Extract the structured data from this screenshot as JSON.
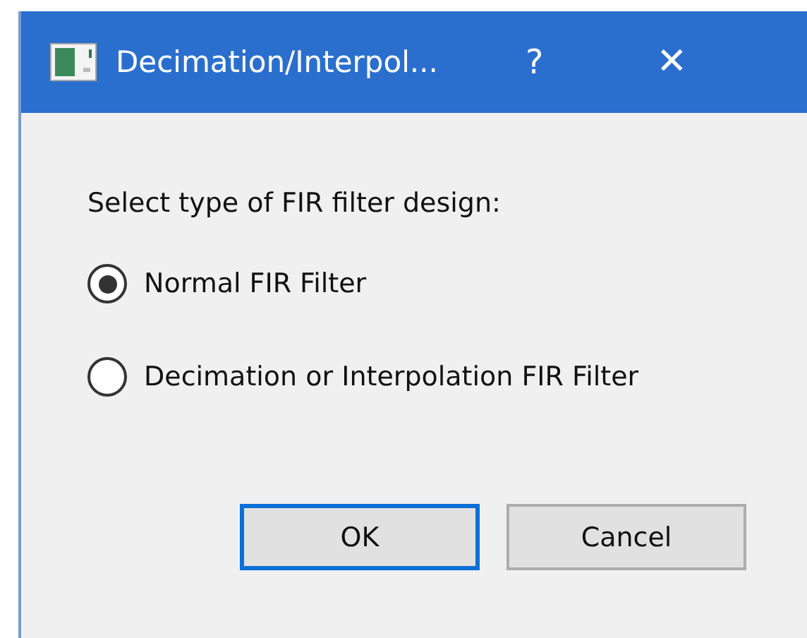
{
  "window": {
    "title": "Decimation/Interpol...",
    "help": "?",
    "close": "✕"
  },
  "prompt": "Select type of FIR filter design:",
  "options": [
    {
      "label": "Normal FIR Filter",
      "selected": true
    },
    {
      "label": "Decimation or Interpolation FIR Filter",
      "selected": false
    }
  ],
  "buttons": [
    {
      "label": "OK",
      "default": true
    },
    {
      "label": "Cancel",
      "default": false
    }
  ]
}
